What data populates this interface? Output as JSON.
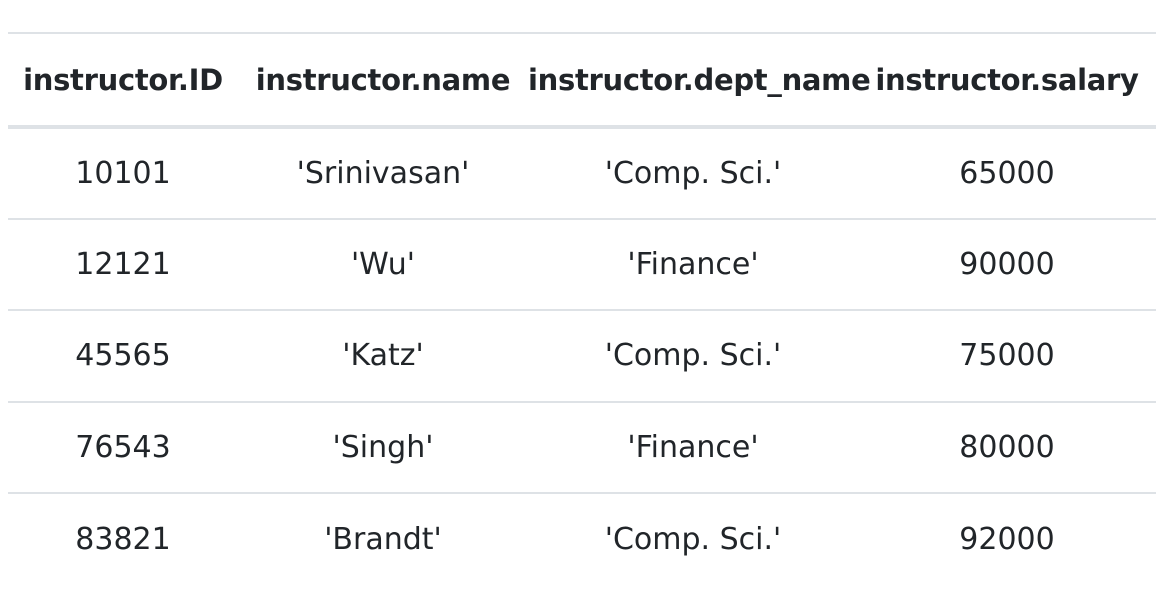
{
  "table": {
    "columns": [
      "instructor.ID",
      "instructor.name",
      "instructor.dept_name",
      "instructor.salary"
    ],
    "rows": [
      [
        "10101",
        "'Srinivasan'",
        "'Comp. Sci.'",
        "65000"
      ],
      [
        "12121",
        "'Wu'",
        "'Finance'",
        "90000"
      ],
      [
        "45565",
        "'Katz'",
        "'Comp. Sci.'",
        "75000"
      ],
      [
        "76543",
        "'Singh'",
        "'Finance'",
        "80000"
      ],
      [
        "83821",
        "'Brandt'",
        "'Comp. Sci.'",
        "92000"
      ]
    ]
  }
}
